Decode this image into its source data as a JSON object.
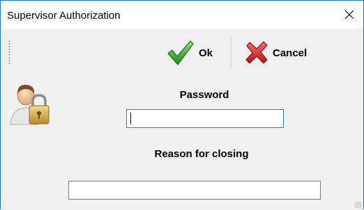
{
  "window": {
    "title": "Supervisor Authorization",
    "close_icon": "close-icon"
  },
  "toolbar": {
    "ok_label": "Ok",
    "ok_icon": "checkmark-icon",
    "cancel_label": "Cancel",
    "cancel_icon": "red-x-icon"
  },
  "form": {
    "user_icon": "user-lock-icon",
    "password_label": "Password",
    "password_value": "",
    "reason_label": "Reason for closing",
    "reason_value": ""
  },
  "colors": {
    "accent": "#2f7ad6",
    "window_border": "#1d6fb8",
    "ok_green": "#3aa632",
    "cancel_red": "#d9262b"
  }
}
